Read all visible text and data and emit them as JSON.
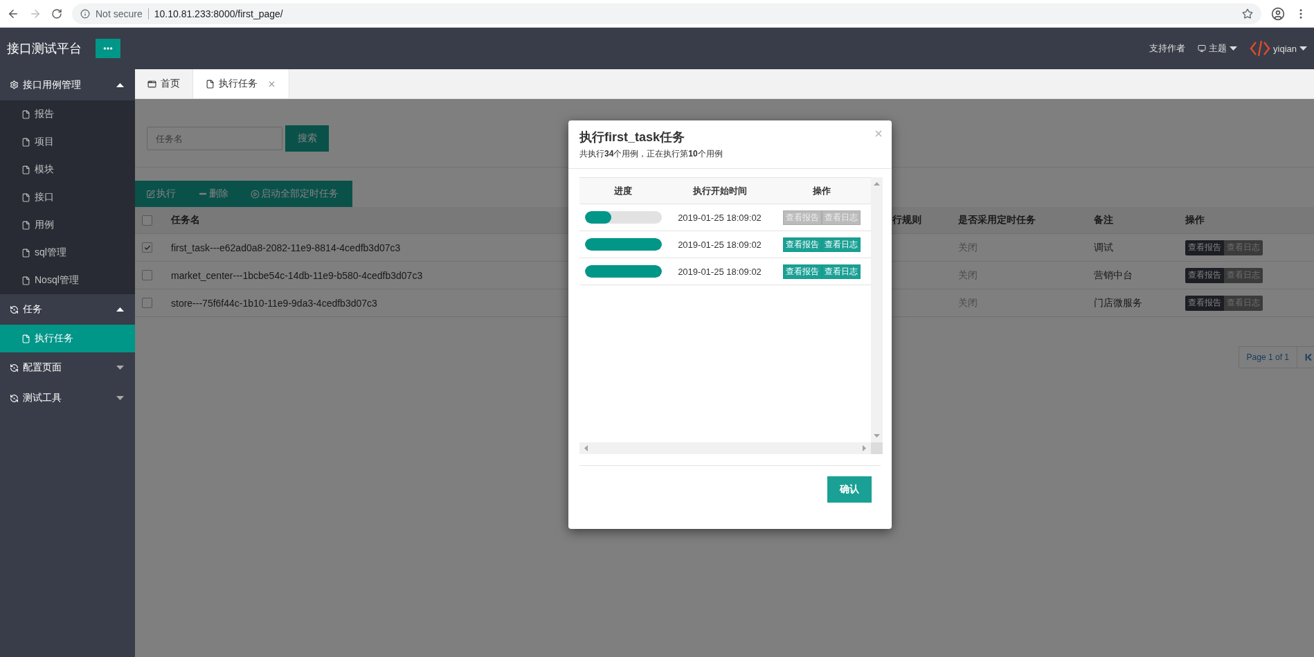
{
  "browser": {
    "security": "Not secure",
    "url": "10.10.81.233:8000/first_page/"
  },
  "header": {
    "title": "接口测试平台",
    "support": "支持作者",
    "theme": "主题",
    "user": "yiqian"
  },
  "sidebar": [
    {
      "kind": "gear",
      "label": "接口用例管理",
      "expanded": true,
      "children": [
        {
          "label": "报告",
          "selected": false
        },
        {
          "label": "项目",
          "selected": false
        },
        {
          "label": "模块",
          "selected": false
        },
        {
          "label": "接口",
          "selected": false
        },
        {
          "label": "用例",
          "selected": false
        },
        {
          "label": "sql管理",
          "selected": false
        },
        {
          "label": "Nosql管理",
          "selected": false
        }
      ]
    },
    {
      "kind": "cycle",
      "label": "任务",
      "expanded": true,
      "children": [
        {
          "label": "执行任务",
          "selected": true
        }
      ]
    },
    {
      "kind": "cycle",
      "label": "配置页面",
      "expanded": false
    },
    {
      "kind": "cycle",
      "label": "测试工具",
      "expanded": false
    }
  ],
  "tabs": [
    {
      "kind": "home",
      "label": "首页",
      "selected": false,
      "closable": false
    },
    {
      "kind": "page",
      "label": "执行任务",
      "selected": true,
      "closable": true
    }
  ],
  "search": {
    "placeholder": "任务名",
    "button": "搜索"
  },
  "toolbar": [
    {
      "kind": "edit",
      "label": "执行"
    },
    {
      "kind": "remove",
      "label": "删除"
    },
    {
      "kind": "play",
      "label": "启动全部定时任务"
    }
  ],
  "table": {
    "select_all_checked": false,
    "columns": [
      "任务名",
      "行规则",
      "是否采用定时任务",
      "备注",
      "操作"
    ],
    "rows": [
      {
        "checked": true,
        "name": "first_task---e62ad0a8-2082-11e9-8814-4cedfb3d07c3",
        "timer": "关闭",
        "note": "调试",
        "actions": [
          "查看报告",
          "查看日志"
        ]
      },
      {
        "checked": false,
        "name": "market_center---1bcbe54c-14db-11e9-b580-4cedfb3d07c3",
        "timer": "关闭",
        "note": "营销中台",
        "actions": [
          "查看报告",
          "查看日志"
        ]
      },
      {
        "checked": false,
        "name": "store---75f6f44c-1b10-11e9-9da3-4cedfb3d07c3",
        "timer": "关闭",
        "note": "门店微服务",
        "actions": [
          "查看报告",
          "查看日志"
        ]
      }
    ]
  },
  "pagination": {
    "label": "Page 1 of 1"
  },
  "modal": {
    "title": "执行first_task任务",
    "summary": "共执行**34**个用例，正在执行第**10**个用例",
    "columns": [
      "进度",
      "执行开始时间",
      "操作"
    ],
    "rows": [
      {
        "level": 0.35,
        "time": "2019-01-25 18:09:02",
        "disabled": true,
        "actions": [
          "查看报告",
          "查看日志"
        ]
      },
      {
        "level": 1,
        "time": "2019-01-25 18:09:02",
        "disabled": false,
        "actions": [
          "查看报告",
          "查看日志"
        ]
      },
      {
        "level": 1,
        "time": "2019-01-25 18:09:02",
        "disabled": false,
        "actions": [
          "查看报告",
          "查看日志"
        ]
      }
    ],
    "confirm": "确认"
  }
}
